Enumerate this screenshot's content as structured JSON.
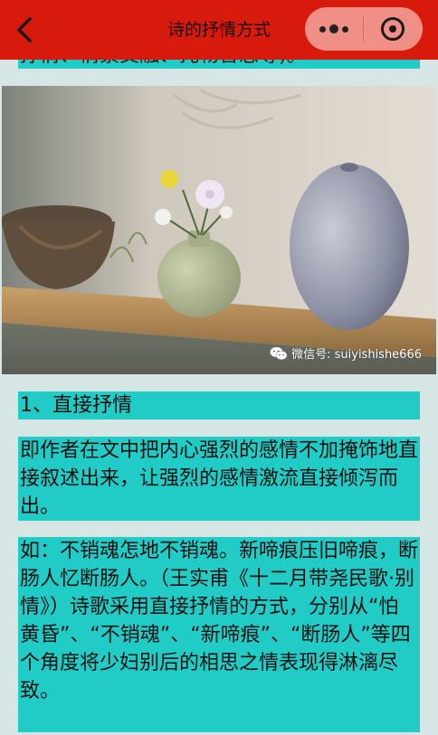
{
  "header": {
    "title": "诗的抒情方式"
  },
  "content": {
    "peek_text": "抒情、情景交融、托物言志等)。",
    "image": {
      "watermark": "微信号: suiyishishe666"
    },
    "section_heading": "1、直接抒情",
    "paragraph_1": "即作者在文中把内心强烈的感情不加掩饰地直接叙述出来，让强烈的感情激流直接倾泻而出。",
    "paragraph_2": "如：不销魂怎地不销魂。新啼痕压旧啼痕，断肠人忆断肠人。（王实甫《十二月带尧民歌·别情》）诗歌采用直接抒情的方式，分别从“怕黄昏”、“不销魂”、“新啼痕”、“断肠人”等四个角度将少妇别后的相思之情表现得淋漓尽致。"
  },
  "colors": {
    "header_bg": "#d71a0b",
    "capsule_bg": "#f08f85",
    "highlight": "#22ccc6",
    "page_bg": "#d6e6e4"
  }
}
